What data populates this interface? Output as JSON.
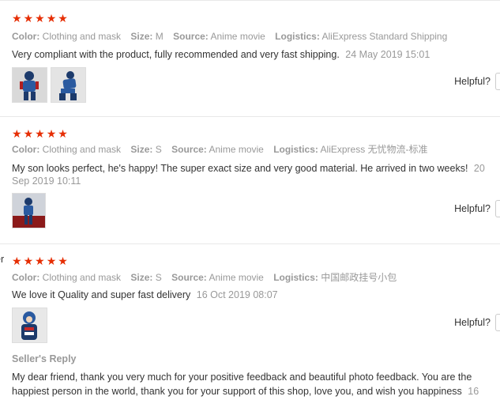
{
  "labels": {
    "color": "Color:",
    "size": "Size:",
    "source": "Source:",
    "logistics": "Logistics:",
    "helpful": "Helpful?"
  },
  "reviews": [
    {
      "rating": 5,
      "color": "Clothing and mask",
      "size": "M",
      "source": "Anime movie",
      "logistics": "AliExpress Standard Shipping",
      "text": "Very compliant with the product, fully recommended and very fast shipping.",
      "date": "24 May 2019 15:01",
      "photos": [
        "photo-1",
        "photo-2"
      ]
    },
    {
      "rating": 5,
      "color": "Clothing and mask",
      "size": "S",
      "source": "Anime movie",
      "logistics": "AliExpress 无忧物流-标准",
      "text": "My son looks perfect, he's happy! The super exact size and very good material. He arrived in two weeks!",
      "date": "20 Sep 2019 10:11",
      "photos": [
        "photo-1"
      ]
    },
    {
      "name_stub": "er",
      "rating": 5,
      "color": "Clothing and mask",
      "size": "S",
      "source": "Anime movie",
      "logistics": "中国邮政挂号小包",
      "text": "We love it Quality and super fast delivery",
      "date": "16 Oct 2019 08:07",
      "photos": [
        "photo-1"
      ],
      "seller_reply": {
        "title": "Seller's Reply",
        "text": "My dear friend, thank you very much for your positive feedback and beautiful photo feedback. You are the happiest person in the world, thank you for your support of this shop, love you, and wish you happiness",
        "date": "16"
      }
    }
  ],
  "colors": {
    "star": "#e62e04",
    "muted": "#999999",
    "text": "#333333",
    "divider": "#e8e8e8"
  }
}
